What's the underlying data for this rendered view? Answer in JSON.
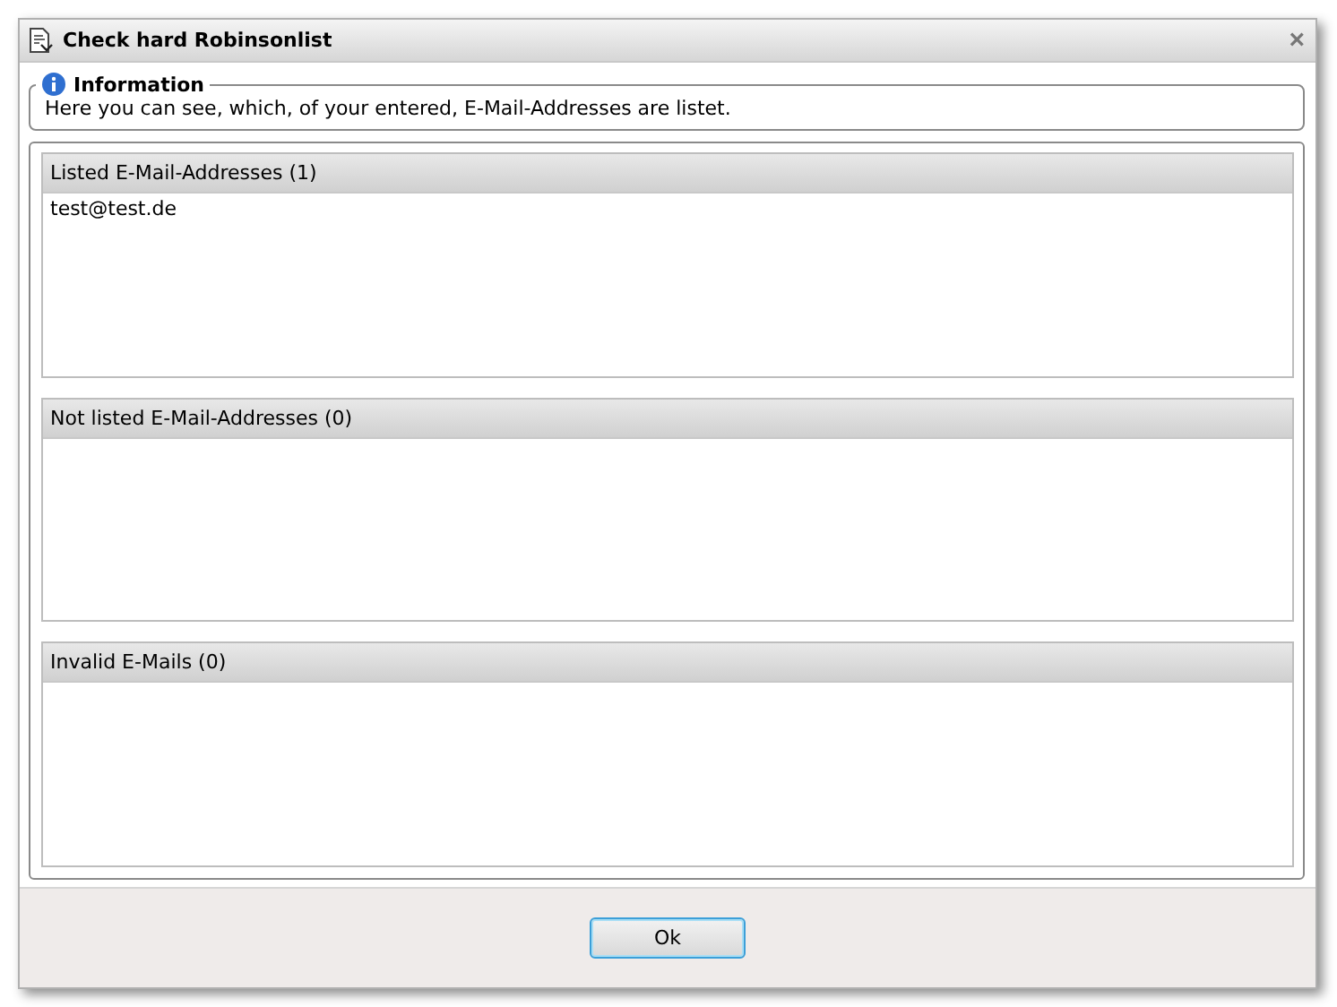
{
  "window": {
    "title": "Check hard Robinsonlist",
    "close": "×"
  },
  "information": {
    "legend": "Information",
    "text": "Here you can see, which, of your entered, E-Mail-Addresses are listet."
  },
  "lists": [
    {
      "header": "Listed E-Mail-Addresses (1)",
      "items": [
        "test@test.de"
      ]
    },
    {
      "header": "Not listed E-Mail-Addresses (0)"
    },
    {
      "header": "Invalid E-Mails (0)"
    }
  ],
  "buttons": [
    {
      "label": "Ok",
      "focused": true
    }
  ]
}
